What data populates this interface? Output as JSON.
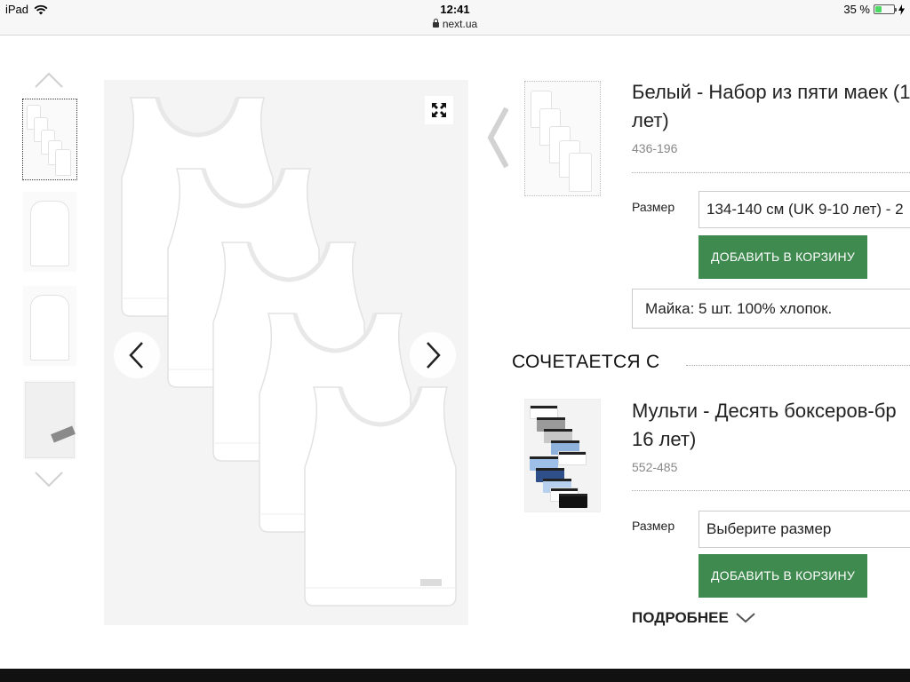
{
  "status_bar": {
    "device": "iPad",
    "time": "12:41",
    "url": "next.ua",
    "battery": "35 %",
    "battery_level": 0.35
  },
  "gallery": {
    "thumbnails": [
      "thumb-1",
      "thumb-2",
      "thumb-3",
      "thumb-4"
    ],
    "active_thumbnail": 0
  },
  "product": {
    "title_line1": "Белый - Набор из пяти маек (1",
    "title_line2": "лет)",
    "code": "436-196",
    "size_label": "Размер",
    "size_value": "134-140 см (UK 9-10 лет) - 2",
    "add_button": "ДОБАВИТЬ В КОРЗИНУ",
    "description": "Майка: 5 шт. 100% хлопок."
  },
  "related": {
    "heading": "СОЧЕТАЕТСЯ С",
    "title_line1": "Мульти - Десять боксеров-бр",
    "title_line2": "16 лет)",
    "code": "552-485",
    "size_label": "Размер",
    "size_placeholder": "Выберите размер",
    "add_button": "ДОБАВИТЬ В КОРЗИНУ"
  },
  "more_link": "ПОДРОБНЕЕ",
  "icons": {
    "wifi": "wifi-icon",
    "lock": "lock-icon",
    "charging": "charging-icon",
    "expand": "expand-icon",
    "prev": "chevron-left-icon",
    "next": "chevron-right-icon",
    "up": "chevron-up-icon",
    "down": "chevron-down-icon"
  },
  "colors": {
    "add_button": "#3f8a4f",
    "battery": "#4cd964"
  }
}
